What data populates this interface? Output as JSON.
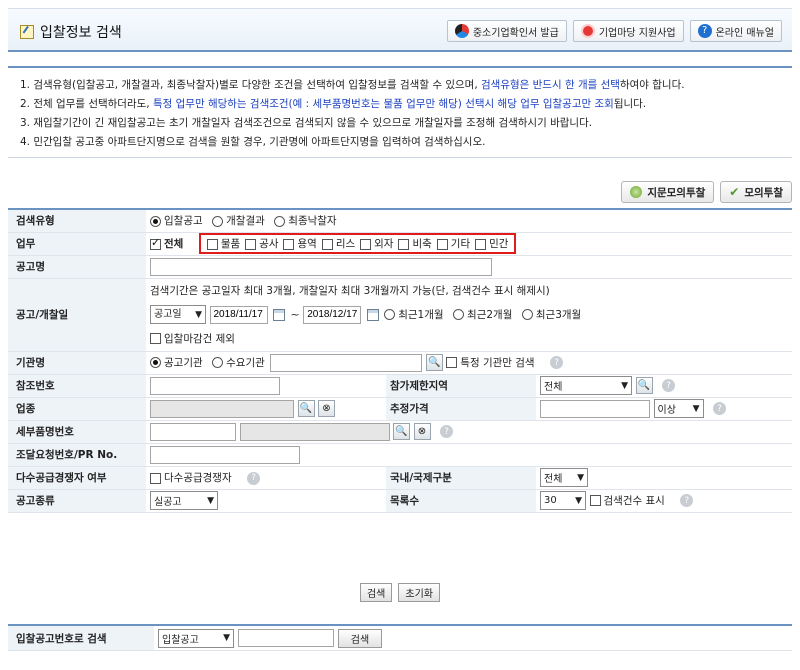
{
  "header": {
    "title": "입찰정보 검색",
    "buttons": [
      {
        "label": "중소기업확인서 발급",
        "icon": "certificate-icon"
      },
      {
        "label": "기업마당 지원사업",
        "icon": "support-icon"
      },
      {
        "label": "온라인 매뉴얼",
        "icon": "help-icon"
      }
    ]
  },
  "notice": {
    "line1_a": "1. 검색유형(입찰공고, 개찰결과, 최종낙찰자)별로 다양한 조건을 선택하여 입찰정보를 검색할 수 있으며, ",
    "line1_b": "검색유형은 반드시 한 개를 선택",
    "line1_c": "하여야 합니다.",
    "line2_a": "2. 전체 업무를 선택하더라도, ",
    "line2_b": "특정 업무만 해당하는 검색조건(예 : 세부품명번호는 물품 업무만 해당) 선택시 해당 업무 입찰공고만 조회",
    "line2_c": "됩니다.",
    "line3": "3. 재입찰기간이 긴 재입찰공고는 초기 개찰일자 검색조건으로 검색되지 않을 수 있으므로 개찰일자를 조정해 검색하시기 바랍니다.",
    "line4": "4. 민간입찰 공고중 아파트단지명으로 검색을 원할 경우, 기관명에 아파트단지명을 입력하여 검색하십시오."
  },
  "mock_buttons": {
    "fingerprint": "지문모의투찰",
    "mock": "모의투찰"
  },
  "form": {
    "search_type": {
      "label": "검색유형",
      "options": [
        "입찰공고",
        "개찰결과",
        "최종낙찰자"
      ],
      "selected": "입찰공고"
    },
    "business": {
      "label": "업무",
      "all": "전체",
      "options": [
        "물품",
        "공사",
        "용역",
        "리스",
        "외자",
        "비축",
        "기타",
        "민간"
      ]
    },
    "notice_name": {
      "label": "공고명",
      "value": ""
    },
    "date": {
      "label": "공고/개찰일",
      "hint": "검색기간은 공고일자 최대 3개월, 개찰일자 최대 3개월까지 가능(단, 검색건수 표시 해제시)",
      "type_value": "공고일",
      "from": "2018/11/17",
      "to": "2018/12/17",
      "tilde": "~",
      "periods": [
        "최근1개월",
        "최근2개월",
        "최근3개월"
      ],
      "exclude_closed": "입찰마감건 제외"
    },
    "agency": {
      "label": "기관명",
      "options": [
        "공고기관",
        "수요기관"
      ],
      "selected": "공고기관",
      "specific_only": "특정 기관만 검색"
    },
    "ref_no": {
      "label": "참조번호"
    },
    "region": {
      "label": "참가제한지역",
      "value": "전체"
    },
    "industry": {
      "label": "업종"
    },
    "est_price": {
      "label": "추정가격",
      "cond": "이상"
    },
    "item_no": {
      "label": "세부품명번호"
    },
    "pr_no": {
      "label": "조달요청번호/PR No."
    },
    "multi_supply": {
      "label": "다수공급경쟁자 여부",
      "check_label": "다수공급경쟁자"
    },
    "intl": {
      "label": "국내/국제구분",
      "value": "전체"
    },
    "notice_type": {
      "label": "공고종류",
      "value": "실공고"
    },
    "list_count": {
      "label": "목록수",
      "value": "30",
      "show_count": "검색건수 표시"
    }
  },
  "actions": {
    "search": "검색",
    "reset": "초기화"
  },
  "bid_no_search": {
    "label": "입찰공고번호로 검색",
    "type_value": "입찰공고",
    "button": "검색"
  }
}
